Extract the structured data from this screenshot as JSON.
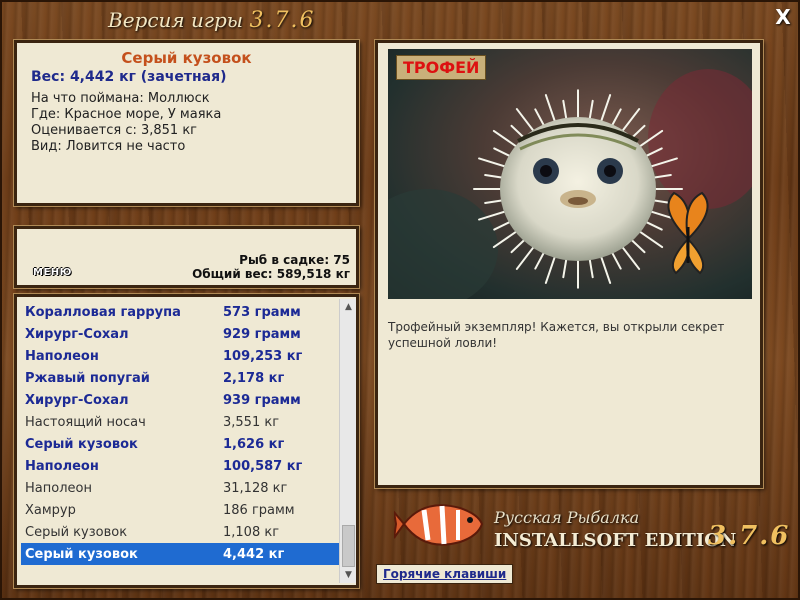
{
  "window": {
    "title_prefix": "Версия игры",
    "title_version": "3.7.6",
    "close_label": "X"
  },
  "catch": {
    "name": "Серый кузовок",
    "weight": "Вес: 4,442 кг (зачетная)",
    "bait": "На что поймана: Моллюск",
    "place": "Где: Красное море, У маяка",
    "valued_from": "Оценивается с: 3,851 кг",
    "rarity": "Вид: Ловится не часто"
  },
  "stats": {
    "menu_label": "МЕНЮ",
    "fish_in_net": "Рыб в садке: 75",
    "total_weight": "Общий вес: 589,518 кг"
  },
  "fish_list": [
    {
      "name": "Коралловая гаррупа",
      "weight": "573 грамм",
      "style": "bold"
    },
    {
      "name": "Хирург-Сохал",
      "weight": "929 грамм",
      "style": "bold"
    },
    {
      "name": "Наполеон",
      "weight": "109,253 кг",
      "style": "bold"
    },
    {
      "name": "Ржавый попугай",
      "weight": "2,178 кг",
      "style": "bold"
    },
    {
      "name": "Хирург-Сохал",
      "weight": "939 грамм",
      "style": "bold"
    },
    {
      "name": "Настоящий носач",
      "weight": "3,551 кг",
      "style": "plain"
    },
    {
      "name": "Серый кузовок",
      "weight": "1,626 кг",
      "style": "bold"
    },
    {
      "name": "Наполеон",
      "weight": "100,587 кг",
      "style": "bold"
    },
    {
      "name": "Наполеон",
      "weight": "31,128 кг",
      "style": "plain"
    },
    {
      "name": "Хамрур",
      "weight": "186 грамм",
      "style": "plain"
    },
    {
      "name": "Серый кузовок",
      "weight": "1,108 кг",
      "style": "plain"
    },
    {
      "name": "Серый кузовок",
      "weight": "4,442 кг",
      "style": "sel"
    }
  ],
  "trophy": {
    "badge": "ТРОФЕЙ",
    "description": "Трофейный экземпляр! Кажется, вы открыли секрет успешной ловли!"
  },
  "footer": {
    "hotkeys_label": "Горячие клавиши",
    "brand_line1": "Русская Рыбалка",
    "brand_line2": "INSTALLSOFT EDITION",
    "brand_version": "3.7.6"
  }
}
